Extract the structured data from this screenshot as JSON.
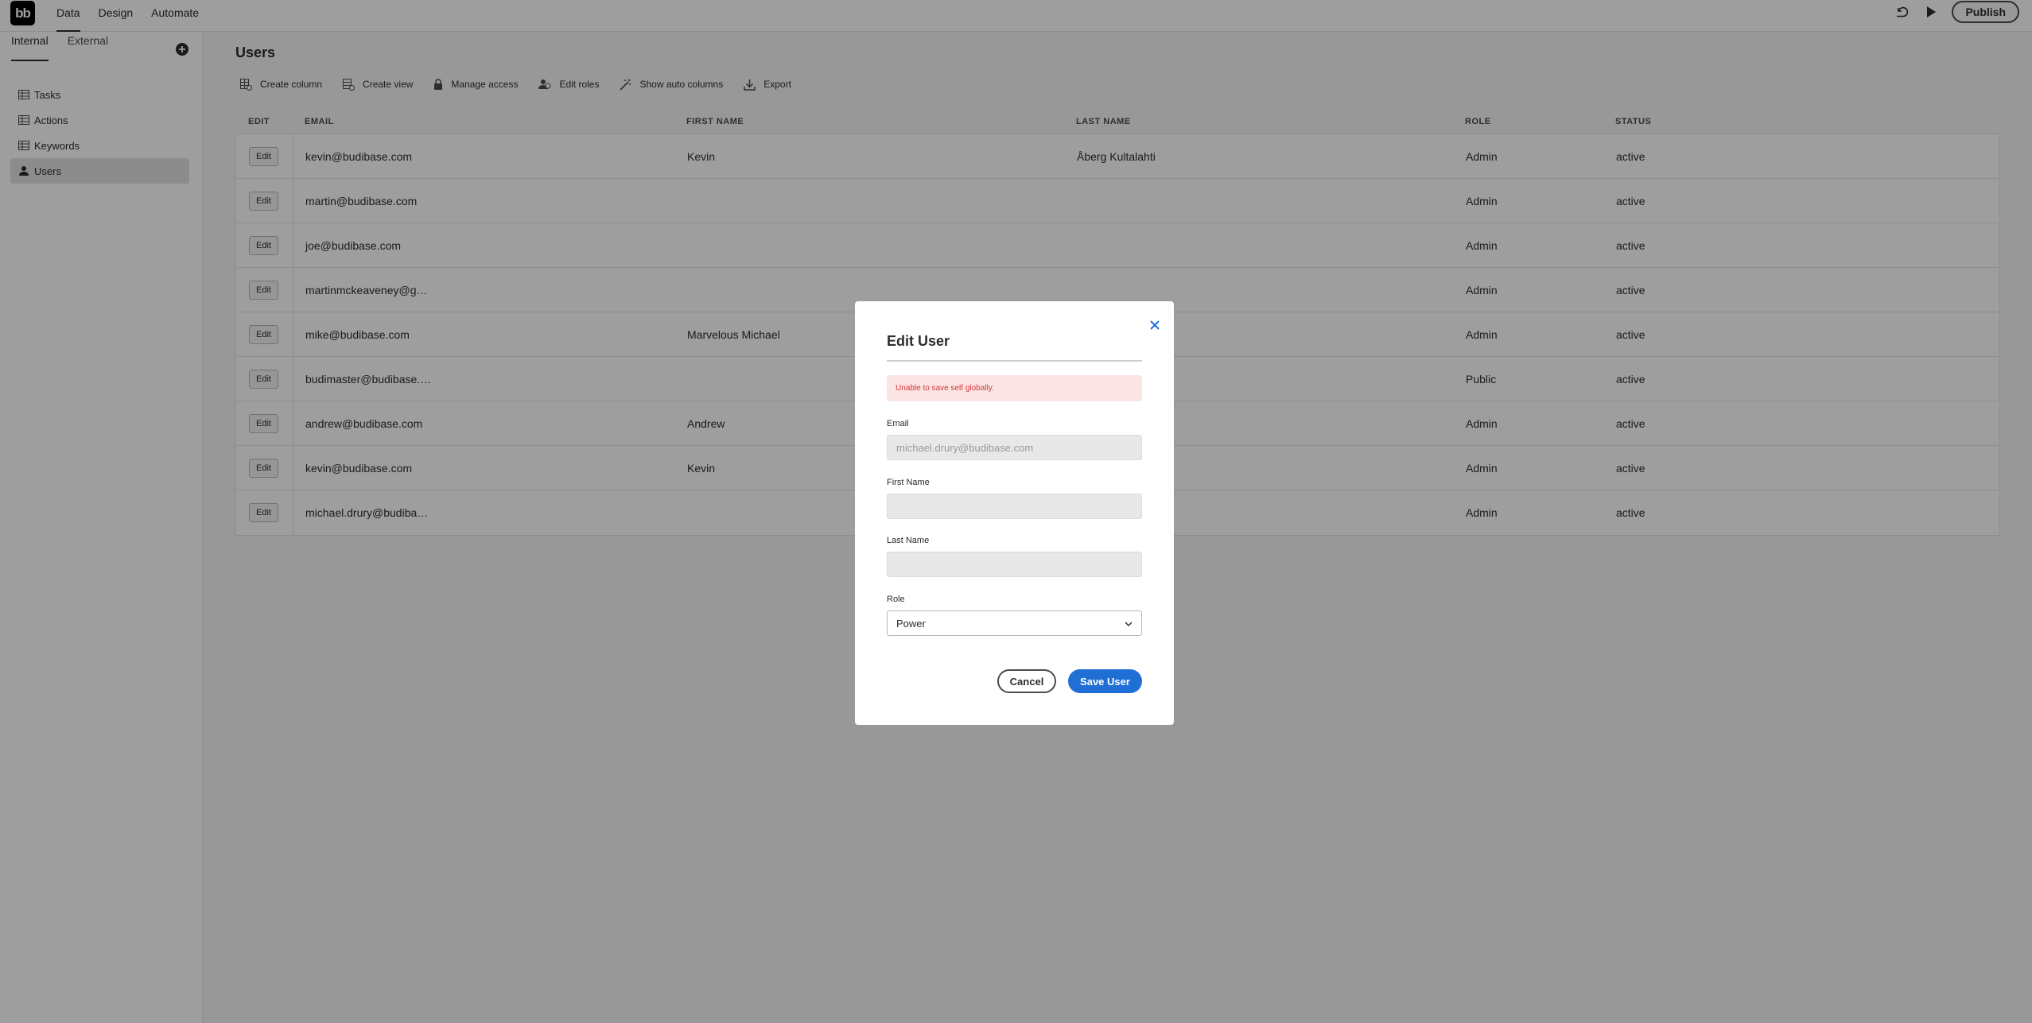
{
  "app": {
    "logo_text": "bb",
    "nav": [
      "Data",
      "Design",
      "Automate"
    ],
    "publish_label": "Publish"
  },
  "sidebar": {
    "tabs": [
      "Internal",
      "External"
    ],
    "items": [
      "Tasks",
      "Actions",
      "Keywords",
      "Users"
    ]
  },
  "main": {
    "title": "Users",
    "toolbar": [
      "Create column",
      "Create view",
      "Manage access",
      "Edit roles",
      "Show auto columns",
      "Export"
    ]
  },
  "table": {
    "headers": [
      "EDIT",
      "EMAIL",
      "FIRST NAME",
      "LAST NAME",
      "ROLE",
      "STATUS"
    ],
    "edit_label": "Edit",
    "rows": [
      {
        "email": "kevin@budibase.com",
        "first": "Kevin",
        "last": "Åberg Kultalahti",
        "role": "Admin",
        "status": "active"
      },
      {
        "email": "martin@budibase.com",
        "first": "",
        "last": "",
        "role": "Admin",
        "status": "active"
      },
      {
        "email": "joe@budibase.com",
        "first": "",
        "last": "",
        "role": "Admin",
        "status": "active"
      },
      {
        "email": "martinmckeaveney@g…",
        "first": "",
        "last": "",
        "role": "Admin",
        "status": "active"
      },
      {
        "email": "mike@budibase.com",
        "first": "Marvelous Michael",
        "last": "",
        "role": "Admin",
        "status": "active"
      },
      {
        "email": "budimaster@budibase.…",
        "first": "",
        "last": "",
        "role": "Public",
        "status": "active"
      },
      {
        "email": "andrew@budibase.com",
        "first": "Andrew",
        "last": "",
        "role": "Admin",
        "status": "active"
      },
      {
        "email": "kevin@budibase.com",
        "first": "Kevin",
        "last": "",
        "role": "Admin",
        "status": "active"
      },
      {
        "email": "michael.drury@budiba…",
        "first": "",
        "last": "",
        "role": "Admin",
        "status": "active"
      }
    ]
  },
  "modal": {
    "title": "Edit User",
    "error": "Unable to save self globally.",
    "email_label": "Email",
    "email_value": "michael.drury@budibase.com",
    "first_label": "First Name",
    "first_value": "",
    "last_label": "Last Name",
    "last_value": "",
    "role_label": "Role",
    "role_value": "Power",
    "cancel_label": "Cancel",
    "save_label": "Save User"
  },
  "colors": {
    "primary": "#1f6fd5",
    "error_bg": "#fbe4e4",
    "error_text": "#d73737"
  }
}
